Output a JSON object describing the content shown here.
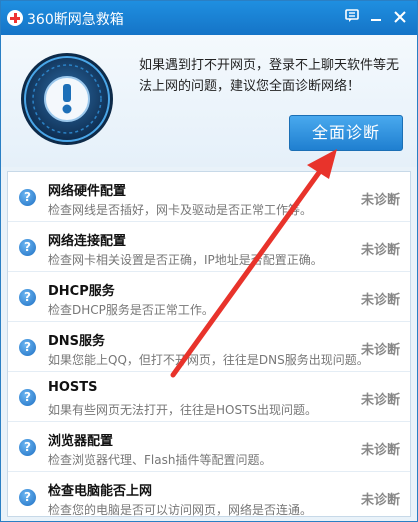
{
  "window": {
    "title": "360断网急救箱"
  },
  "titlebar": {
    "menu_icon": "feedback-icon",
    "minimize_icon": "minimize-icon",
    "close_icon": "close-icon"
  },
  "header": {
    "description": "如果遇到打不开网页，登录不上聊天软件等无法上网的问题，建议您全面诊断网络！",
    "diagnose_button": "全面诊断"
  },
  "items": [
    {
      "title": "网络硬件配置",
      "desc": "检查网线是否插好，网卡及驱动是否正常工作等。",
      "status": "未诊断"
    },
    {
      "title": "网络连接配置",
      "desc": "检查网卡相关设置是否正确，IP地址是否配置正确。",
      "status": "未诊断"
    },
    {
      "title": "DHCP服务",
      "desc": "检查DHCP服务是否正常工作。",
      "status": "未诊断"
    },
    {
      "title": "DNS服务",
      "desc": "如果您能上QQ，但打不开网页，往往是DNS服务出现问题。",
      "status": "未诊断"
    },
    {
      "title": "HOSTS",
      "desc": "如果有些网页无法打开，往往是HOSTS出现问题。",
      "status": "未诊断"
    },
    {
      "title": "浏览器配置",
      "desc": "检查浏览器代理、Flash插件等配置问题。",
      "status": "未诊断"
    },
    {
      "title": "检查电脑能否上网",
      "desc": "检查您的电脑是否可以访问网页，网络是否连通。",
      "status": "未诊断"
    }
  ],
  "colors": {
    "accent": "#1f7fd0",
    "arrow": "#e8332b",
    "status": "#888888"
  }
}
